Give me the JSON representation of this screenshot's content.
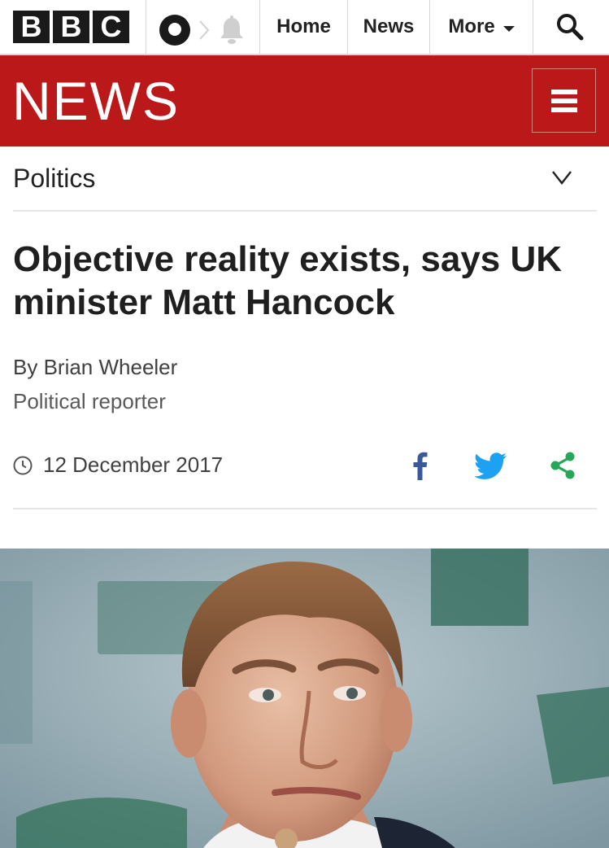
{
  "header": {
    "logo_letters": [
      "B",
      "B",
      "C"
    ],
    "nav": {
      "home_label": "Home",
      "news_label": "News",
      "more_label": "More"
    },
    "icons": {
      "account": "account-icon",
      "notifications": "bell-icon",
      "search": "search-icon",
      "more_caret": "caret-down-icon"
    }
  },
  "brand": {
    "title": "NEWS",
    "menu_icon": "hamburger-menu-icon",
    "colors": {
      "brand_red": "#bb1919",
      "logo_black": "#1a1a1a"
    }
  },
  "section": {
    "label": "Politics",
    "icon": "chevron-down-icon"
  },
  "article": {
    "headline": "Objective reality exists, says UK minister Matt Hancock",
    "byline": "By Brian Wheeler",
    "role": "Political reporter",
    "date": "12 December 2017",
    "share": {
      "facebook_icon": "facebook-icon",
      "twitter_icon": "twitter-icon",
      "share_icon": "share-icon",
      "colors": {
        "facebook": "#3b5998",
        "twitter": "#1da1f2",
        "share": "#26a65b"
      }
    },
    "image": {
      "subject": "photo of Matt Hancock"
    }
  }
}
